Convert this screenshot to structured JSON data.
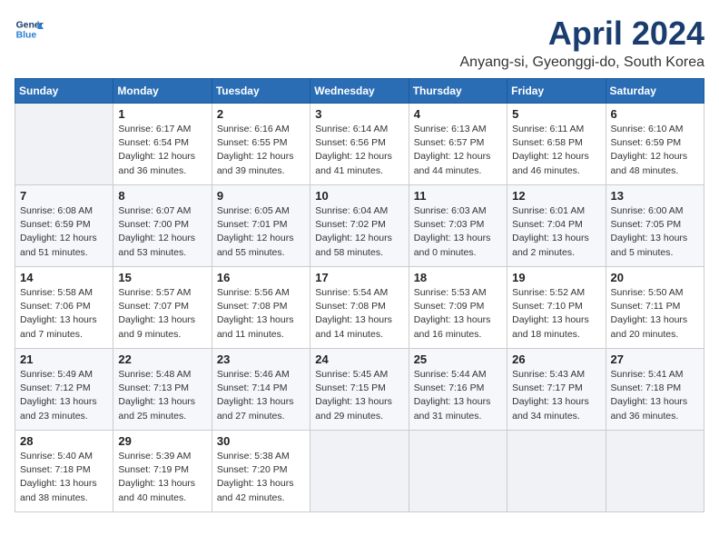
{
  "header": {
    "logo_line1": "General",
    "logo_line2": "Blue",
    "month_year": "April 2024",
    "location": "Anyang-si, Gyeonggi-do, South Korea"
  },
  "weekdays": [
    "Sunday",
    "Monday",
    "Tuesday",
    "Wednesday",
    "Thursday",
    "Friday",
    "Saturday"
  ],
  "weeks": [
    [
      {
        "day": "",
        "detail": ""
      },
      {
        "day": "1",
        "detail": "Sunrise: 6:17 AM\nSunset: 6:54 PM\nDaylight: 12 hours\nand 36 minutes."
      },
      {
        "day": "2",
        "detail": "Sunrise: 6:16 AM\nSunset: 6:55 PM\nDaylight: 12 hours\nand 39 minutes."
      },
      {
        "day": "3",
        "detail": "Sunrise: 6:14 AM\nSunset: 6:56 PM\nDaylight: 12 hours\nand 41 minutes."
      },
      {
        "day": "4",
        "detail": "Sunrise: 6:13 AM\nSunset: 6:57 PM\nDaylight: 12 hours\nand 44 minutes."
      },
      {
        "day": "5",
        "detail": "Sunrise: 6:11 AM\nSunset: 6:58 PM\nDaylight: 12 hours\nand 46 minutes."
      },
      {
        "day": "6",
        "detail": "Sunrise: 6:10 AM\nSunset: 6:59 PM\nDaylight: 12 hours\nand 48 minutes."
      }
    ],
    [
      {
        "day": "7",
        "detail": "Sunrise: 6:08 AM\nSunset: 6:59 PM\nDaylight: 12 hours\nand 51 minutes."
      },
      {
        "day": "8",
        "detail": "Sunrise: 6:07 AM\nSunset: 7:00 PM\nDaylight: 12 hours\nand 53 minutes."
      },
      {
        "day": "9",
        "detail": "Sunrise: 6:05 AM\nSunset: 7:01 PM\nDaylight: 12 hours\nand 55 minutes."
      },
      {
        "day": "10",
        "detail": "Sunrise: 6:04 AM\nSunset: 7:02 PM\nDaylight: 12 hours\nand 58 minutes."
      },
      {
        "day": "11",
        "detail": "Sunrise: 6:03 AM\nSunset: 7:03 PM\nDaylight: 13 hours\nand 0 minutes."
      },
      {
        "day": "12",
        "detail": "Sunrise: 6:01 AM\nSunset: 7:04 PM\nDaylight: 13 hours\nand 2 minutes."
      },
      {
        "day": "13",
        "detail": "Sunrise: 6:00 AM\nSunset: 7:05 PM\nDaylight: 13 hours\nand 5 minutes."
      }
    ],
    [
      {
        "day": "14",
        "detail": "Sunrise: 5:58 AM\nSunset: 7:06 PM\nDaylight: 13 hours\nand 7 minutes."
      },
      {
        "day": "15",
        "detail": "Sunrise: 5:57 AM\nSunset: 7:07 PM\nDaylight: 13 hours\nand 9 minutes."
      },
      {
        "day": "16",
        "detail": "Sunrise: 5:56 AM\nSunset: 7:08 PM\nDaylight: 13 hours\nand 11 minutes."
      },
      {
        "day": "17",
        "detail": "Sunrise: 5:54 AM\nSunset: 7:08 PM\nDaylight: 13 hours\nand 14 minutes."
      },
      {
        "day": "18",
        "detail": "Sunrise: 5:53 AM\nSunset: 7:09 PM\nDaylight: 13 hours\nand 16 minutes."
      },
      {
        "day": "19",
        "detail": "Sunrise: 5:52 AM\nSunset: 7:10 PM\nDaylight: 13 hours\nand 18 minutes."
      },
      {
        "day": "20",
        "detail": "Sunrise: 5:50 AM\nSunset: 7:11 PM\nDaylight: 13 hours\nand 20 minutes."
      }
    ],
    [
      {
        "day": "21",
        "detail": "Sunrise: 5:49 AM\nSunset: 7:12 PM\nDaylight: 13 hours\nand 23 minutes."
      },
      {
        "day": "22",
        "detail": "Sunrise: 5:48 AM\nSunset: 7:13 PM\nDaylight: 13 hours\nand 25 minutes."
      },
      {
        "day": "23",
        "detail": "Sunrise: 5:46 AM\nSunset: 7:14 PM\nDaylight: 13 hours\nand 27 minutes."
      },
      {
        "day": "24",
        "detail": "Sunrise: 5:45 AM\nSunset: 7:15 PM\nDaylight: 13 hours\nand 29 minutes."
      },
      {
        "day": "25",
        "detail": "Sunrise: 5:44 AM\nSunset: 7:16 PM\nDaylight: 13 hours\nand 31 minutes."
      },
      {
        "day": "26",
        "detail": "Sunrise: 5:43 AM\nSunset: 7:17 PM\nDaylight: 13 hours\nand 34 minutes."
      },
      {
        "day": "27",
        "detail": "Sunrise: 5:41 AM\nSunset: 7:18 PM\nDaylight: 13 hours\nand 36 minutes."
      }
    ],
    [
      {
        "day": "28",
        "detail": "Sunrise: 5:40 AM\nSunset: 7:18 PM\nDaylight: 13 hours\nand 38 minutes."
      },
      {
        "day": "29",
        "detail": "Sunrise: 5:39 AM\nSunset: 7:19 PM\nDaylight: 13 hours\nand 40 minutes."
      },
      {
        "day": "30",
        "detail": "Sunrise: 5:38 AM\nSunset: 7:20 PM\nDaylight: 13 hours\nand 42 minutes."
      },
      {
        "day": "",
        "detail": ""
      },
      {
        "day": "",
        "detail": ""
      },
      {
        "day": "",
        "detail": ""
      },
      {
        "day": "",
        "detail": ""
      }
    ]
  ]
}
